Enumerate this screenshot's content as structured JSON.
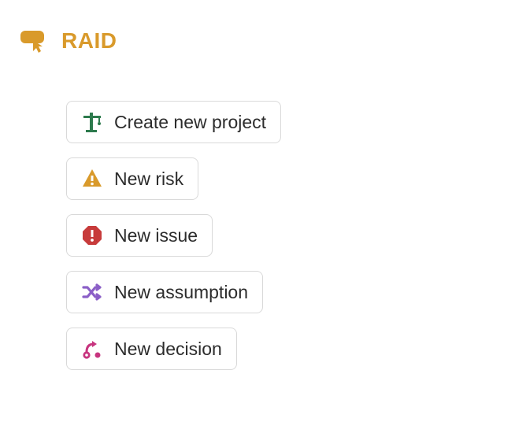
{
  "header": {
    "title": "RAID",
    "icon": "cursor-button-icon",
    "accent_color": "#d99a2b"
  },
  "actions": [
    {
      "id": "create-project",
      "label": "Create new project",
      "icon": "crane-icon",
      "icon_color": "#2d7a4d"
    },
    {
      "id": "new-risk",
      "label": "New risk",
      "icon": "warning-triangle-icon",
      "icon_color": "#d99a2b"
    },
    {
      "id": "new-issue",
      "label": "New issue",
      "icon": "stop-octagon-icon",
      "icon_color": "#c73b3b"
    },
    {
      "id": "new-assumption",
      "label": "New assumption",
      "icon": "shuffle-icon",
      "icon_color": "#8b5fc7"
    },
    {
      "id": "new-decision",
      "label": "New decision",
      "icon": "path-icon",
      "icon_color": "#c7357f"
    }
  ]
}
